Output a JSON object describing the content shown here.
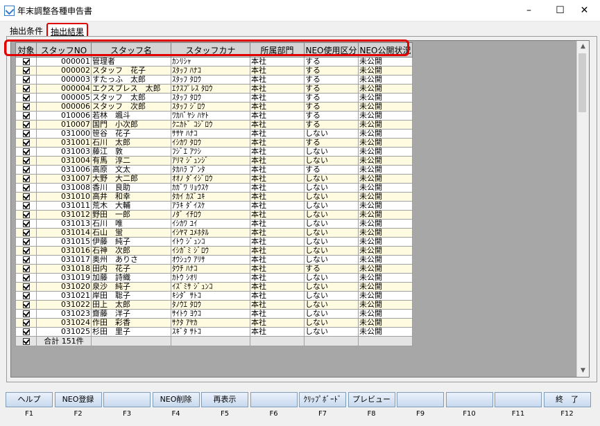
{
  "window": {
    "title": "年末調整各種申告書",
    "minimize": "–",
    "maximize": "☐",
    "close": "✕"
  },
  "tabs": [
    {
      "label": "抽出条件"
    },
    {
      "label": "抽出結果"
    }
  ],
  "grid": {
    "columns": [
      "対象",
      "スタッフNO",
      "スタッフ名",
      "スタッフカナ",
      "所属部門",
      "NEO使用区分",
      "NEO公開状況"
    ],
    "rows": [
      [
        "000001",
        "管理者",
        "ｶﾝﾘｼｬ",
        "本社",
        "する",
        "未公開"
      ],
      [
        "000002",
        "スタッフ　花子",
        "ｽﾀｯﾌ ﾊﾅｺ",
        "本社",
        "する",
        "未公開"
      ],
      [
        "000003",
        "すたっふ　太郎",
        "ｽﾀｯﾌ ﾀﾛｳ",
        "本社",
        "する",
        "未公開"
      ],
      [
        "000004",
        "エクスプレス　太郎",
        "ｴｸｽﾌﾟﾚｽ ﾀﾛｳ",
        "本社",
        "する",
        "未公開"
      ],
      [
        "000005",
        "スタッフ　太郎",
        "ｽﾀｯﾌ ﾀﾛｳ",
        "本社",
        "する",
        "未公開"
      ],
      [
        "000006",
        "スタッフ　次郎",
        "ｽﾀｯﾌ ｼﾞﾛｳ",
        "本社",
        "する",
        "未公開"
      ],
      [
        "010006",
        "若林　颯斗",
        "ﾜｶﾊﾞﾔｼ ﾊﾔﾄ",
        "本社",
        "する",
        "未公開"
      ],
      [
        "010007",
        "国門　小次郎",
        "ｸﾆｶﾄﾞ ｺｼﾞﾛｳ",
        "本社",
        "する",
        "未公開"
      ],
      [
        "031000",
        "笹谷　花子",
        "ｻｻﾔ ﾊﾅｺ",
        "本社",
        "しない",
        "未公開"
      ],
      [
        "031001",
        "石川　太郎",
        "ｲｼｶﾜ ﾀﾛｳ",
        "本社",
        "する",
        "未公開"
      ],
      [
        "031003",
        "藤江　敦",
        "ﾌｼﾞｴ ｱﾂｼ",
        "本社",
        "しない",
        "未公開"
      ],
      [
        "031004",
        "有馬　淳二",
        "ｱﾘﾏ ｼﾞｭﾝｼﾞ",
        "本社",
        "しない",
        "未公開"
      ],
      [
        "031006",
        "高原　文太",
        "ﾀｶﾊﾗ ﾌﾞﾝﾀ",
        "本社",
        "する",
        "未公開"
      ],
      [
        "031007",
        "大野　大二郎",
        "ｵｵﾉ ﾀﾞｲｼﾞﾛｳ",
        "本社",
        "しない",
        "未公開"
      ],
      [
        "031008",
        "香川　良助",
        "ｶｶﾞﾜ ﾘｮｳｽｹ",
        "本社",
        "しない",
        "未公開"
      ],
      [
        "031010",
        "高井　和幸",
        "ﾀｶｲ ｶｽﾞﾕｷ",
        "本社",
        "しない",
        "未公開"
      ],
      [
        "031011",
        "荒木　大輔",
        "ｱﾗｷ ﾀﾞｲｽｹ",
        "本社",
        "しない",
        "未公開"
      ],
      [
        "031012",
        "野田　一郎",
        "ﾉﾀﾞ ｲﾁﾛｳ",
        "本社",
        "しない",
        "未公開"
      ],
      [
        "031013",
        "石川　唯",
        "ｲｼｶﾜ ﾕｲ",
        "本社",
        "しない",
        "未公開"
      ],
      [
        "031014",
        "石山　蛍",
        "ｲｼﾔﾏ ﾕﾒﾎﾀﾙ",
        "本社",
        "しない",
        "未公開"
      ],
      [
        "031015",
        "伊藤　純子",
        "ｲﾄｳ ｼﾞｭﾝｺ",
        "本社",
        "しない",
        "未公開"
      ],
      [
        "031016",
        "石神　次郎",
        "ｲｼｶﾞﾐ ｼﾞﾛｳ",
        "本社",
        "しない",
        "未公開"
      ],
      [
        "031017",
        "奥州　ありさ",
        "ｵｳｼｭｳ ｱﾘｻ",
        "本社",
        "しない",
        "未公開"
      ],
      [
        "031018",
        "田内　花子",
        "ﾀｳﾁ ﾊﾅｺ",
        "本社",
        "する",
        "未公開"
      ],
      [
        "031019",
        "加藤　詩織",
        "ｶﾄｳ ｼｵﾘ",
        "本社",
        "しない",
        "未公開"
      ],
      [
        "031020",
        "泉沙　純子",
        "ｲｽﾞﾐｻ ｼﾞｭﾝｺ",
        "本社",
        "しない",
        "未公開"
      ],
      [
        "031021",
        "岸田　聡子",
        "ｷｼﾀﾞ ｻﾄｺ",
        "本社",
        "しない",
        "未公開"
      ],
      [
        "031022",
        "田上　太郎",
        "ﾀﾉｳｴ ﾀﾛｳ",
        "本社",
        "しない",
        "未公開"
      ],
      [
        "031023",
        "齋藤　洋子",
        "ｻｲﾄｳ ﾖｳｺ",
        "本社",
        "しない",
        "未公開"
      ],
      [
        "031024",
        "作田　彩香",
        "ｻｸﾀ ｱﾔｶ",
        "本社",
        "しない",
        "未公開"
      ],
      [
        "031025",
        "杉田　里子",
        "ｽｷﾞﾀ ｻﾄｺ",
        "本社",
        "しない",
        "未公開"
      ]
    ],
    "total_label": "合計 151件"
  },
  "fkeys": [
    {
      "label": "ヘルプ",
      "key": "F1"
    },
    {
      "label": "NEO登録",
      "key": "F2"
    },
    {
      "label": "",
      "key": "F3"
    },
    {
      "label": "NEO削除",
      "key": "F4"
    },
    {
      "label": "再表示",
      "key": "F5"
    },
    {
      "label": "",
      "key": "F6"
    },
    {
      "label": "ｸﾘｯﾌﾟﾎﾞｰﾄﾞ",
      "key": "F7"
    },
    {
      "label": "プレビュー",
      "key": "F8"
    },
    {
      "label": "",
      "key": "F9"
    },
    {
      "label": "",
      "key": "F10"
    },
    {
      "label": "",
      "key": "F11"
    },
    {
      "label": "終　了",
      "key": "F12"
    }
  ]
}
